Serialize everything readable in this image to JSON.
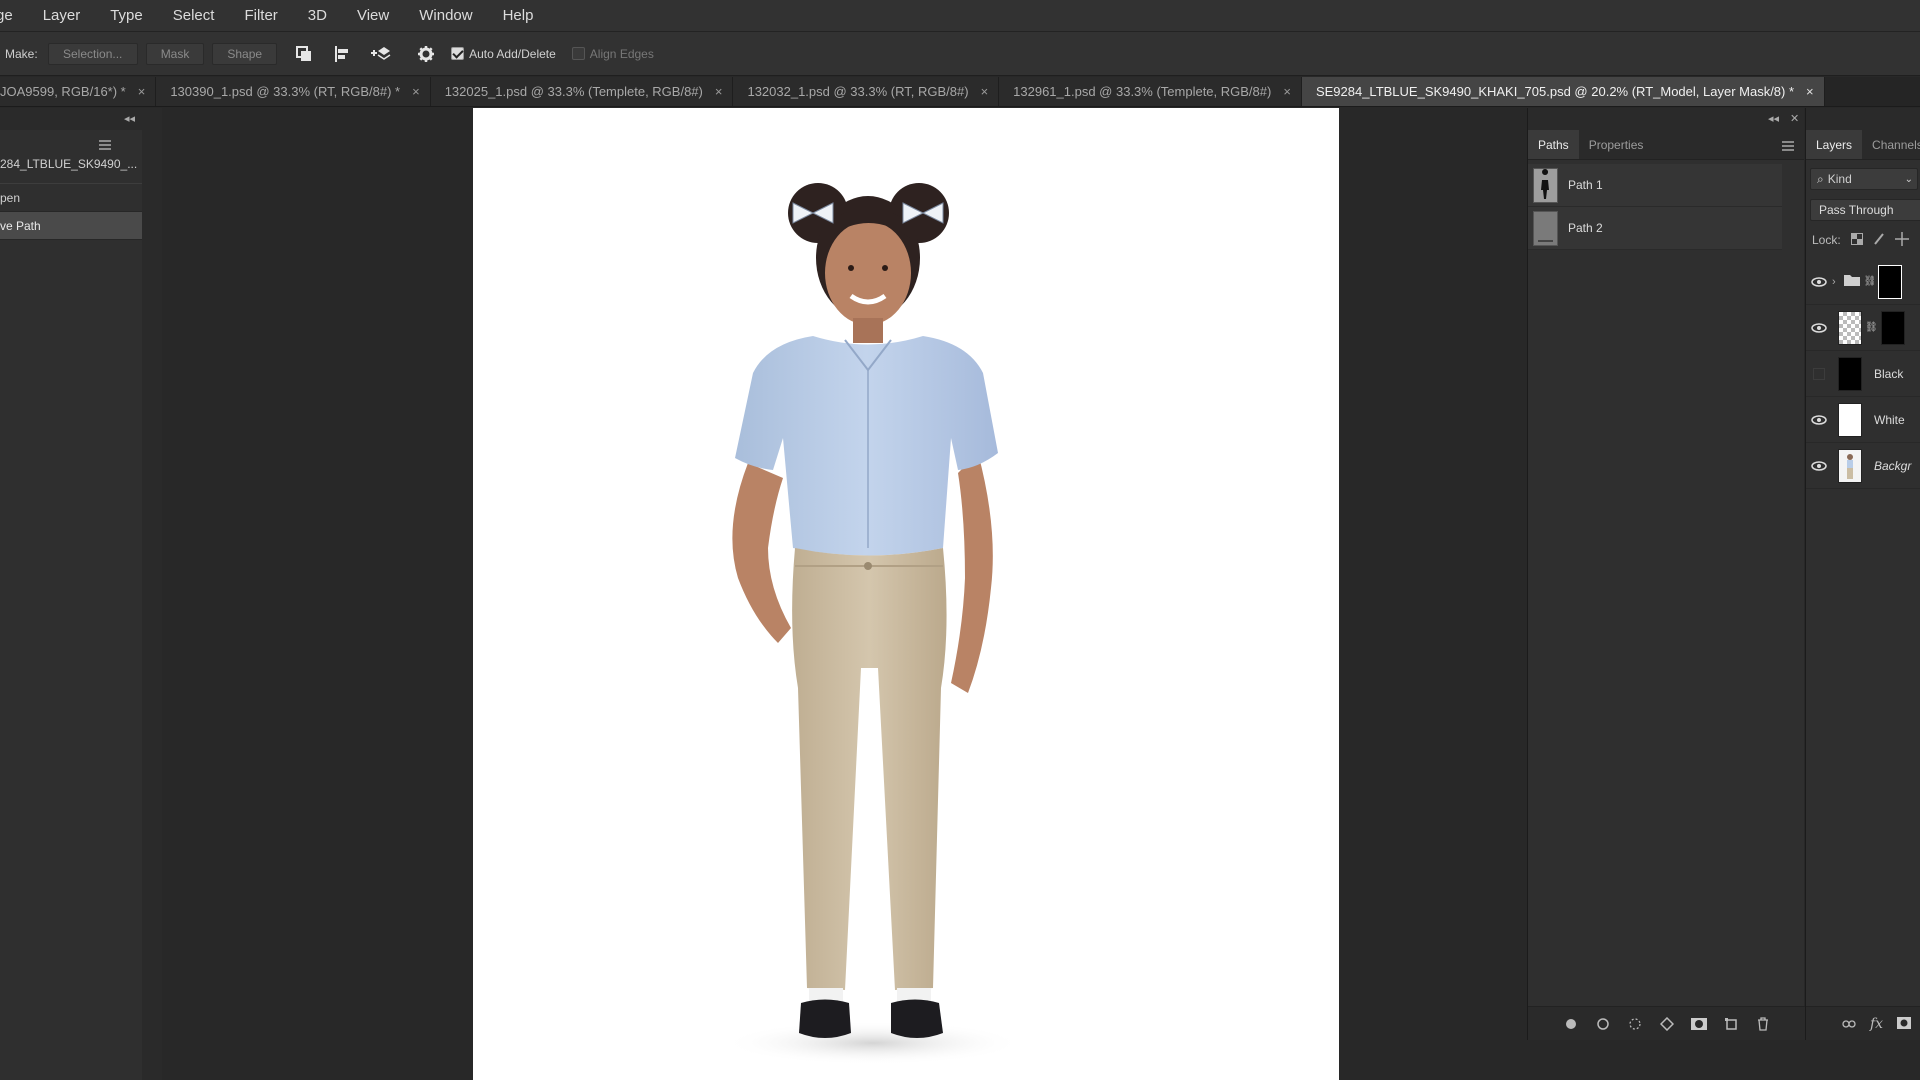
{
  "menubar": {
    "items": [
      "ge",
      "Layer",
      "Type",
      "Select",
      "Filter",
      "3D",
      "View",
      "Window",
      "Help"
    ]
  },
  "options": {
    "make_label": "Make:",
    "selection_button": "Selection...",
    "mask_button": "Mask",
    "shape_button": "Shape",
    "auto_add_delete": "Auto Add/Delete",
    "align_edges": "Align Edges",
    "icons": [
      "path-operations-icon",
      "path-alignment-icon",
      "path-arrangement-icon",
      "gear-icon"
    ]
  },
  "tabs": [
    {
      "label": "JOA9599, RGB/16*) *",
      "active": false
    },
    {
      "label": "130390_1.psd @ 33.3% (RT, RGB/8#) *",
      "active": false
    },
    {
      "label": "132025_1.psd @ 33.3% (Templete, RGB/8#)",
      "active": false
    },
    {
      "label": "132032_1.psd @ 33.3% (RT, RGB/8#)",
      "active": false
    },
    {
      "label": "132961_1.psd @ 33.3% (Templete, RGB/8#)",
      "active": false
    },
    {
      "label": "SE9284_LTBLUE_SK9490_KHAKI_705.psd @ 20.2% (RT_Model, Layer Mask/8) *",
      "active": true
    }
  ],
  "tab_close_glyph": "×",
  "left_panel": {
    "snapshot": "284_LTBLUE_SK9490_...",
    "items": [
      {
        "label": "pen",
        "active": false
      },
      {
        "label": "ve Path",
        "active": true
      }
    ]
  },
  "paths_panel": {
    "tabs": [
      "Paths",
      "Properties"
    ],
    "active_tab": "Paths",
    "paths": [
      "Path 1",
      "Path 2"
    ],
    "bottom_icons": [
      "fill-path-icon",
      "stroke-path-icon",
      "load-selection-icon",
      "make-work-path-icon",
      "add-mask-icon",
      "new-path-icon",
      "trash-icon"
    ]
  },
  "layers_panel": {
    "tabs": [
      "Layers",
      "Channels"
    ],
    "active_tab": "Layers",
    "filter": "Kind",
    "blend_mode": "Pass Through",
    "lock_label": "Lock:",
    "layers": [
      {
        "name": "",
        "type": "group",
        "visible": true
      },
      {
        "name": "",
        "type": "masked",
        "visible": true
      },
      {
        "name": "Black",
        "type": "fill-black",
        "visible": false
      },
      {
        "name": "White",
        "type": "fill-white",
        "visible": true
      },
      {
        "name": "Backgr",
        "type": "background",
        "visible": true
      }
    ],
    "bottom": {
      "link": "link-icon",
      "fx": "fx",
      "mask": "add-layer-mask-icon"
    }
  },
  "colors": {
    "shirt": "#b9cde8",
    "pants": "#cbbda3",
    "skin": "#b98365",
    "hair": "#2e2220",
    "shoes": "#1d1c20"
  }
}
